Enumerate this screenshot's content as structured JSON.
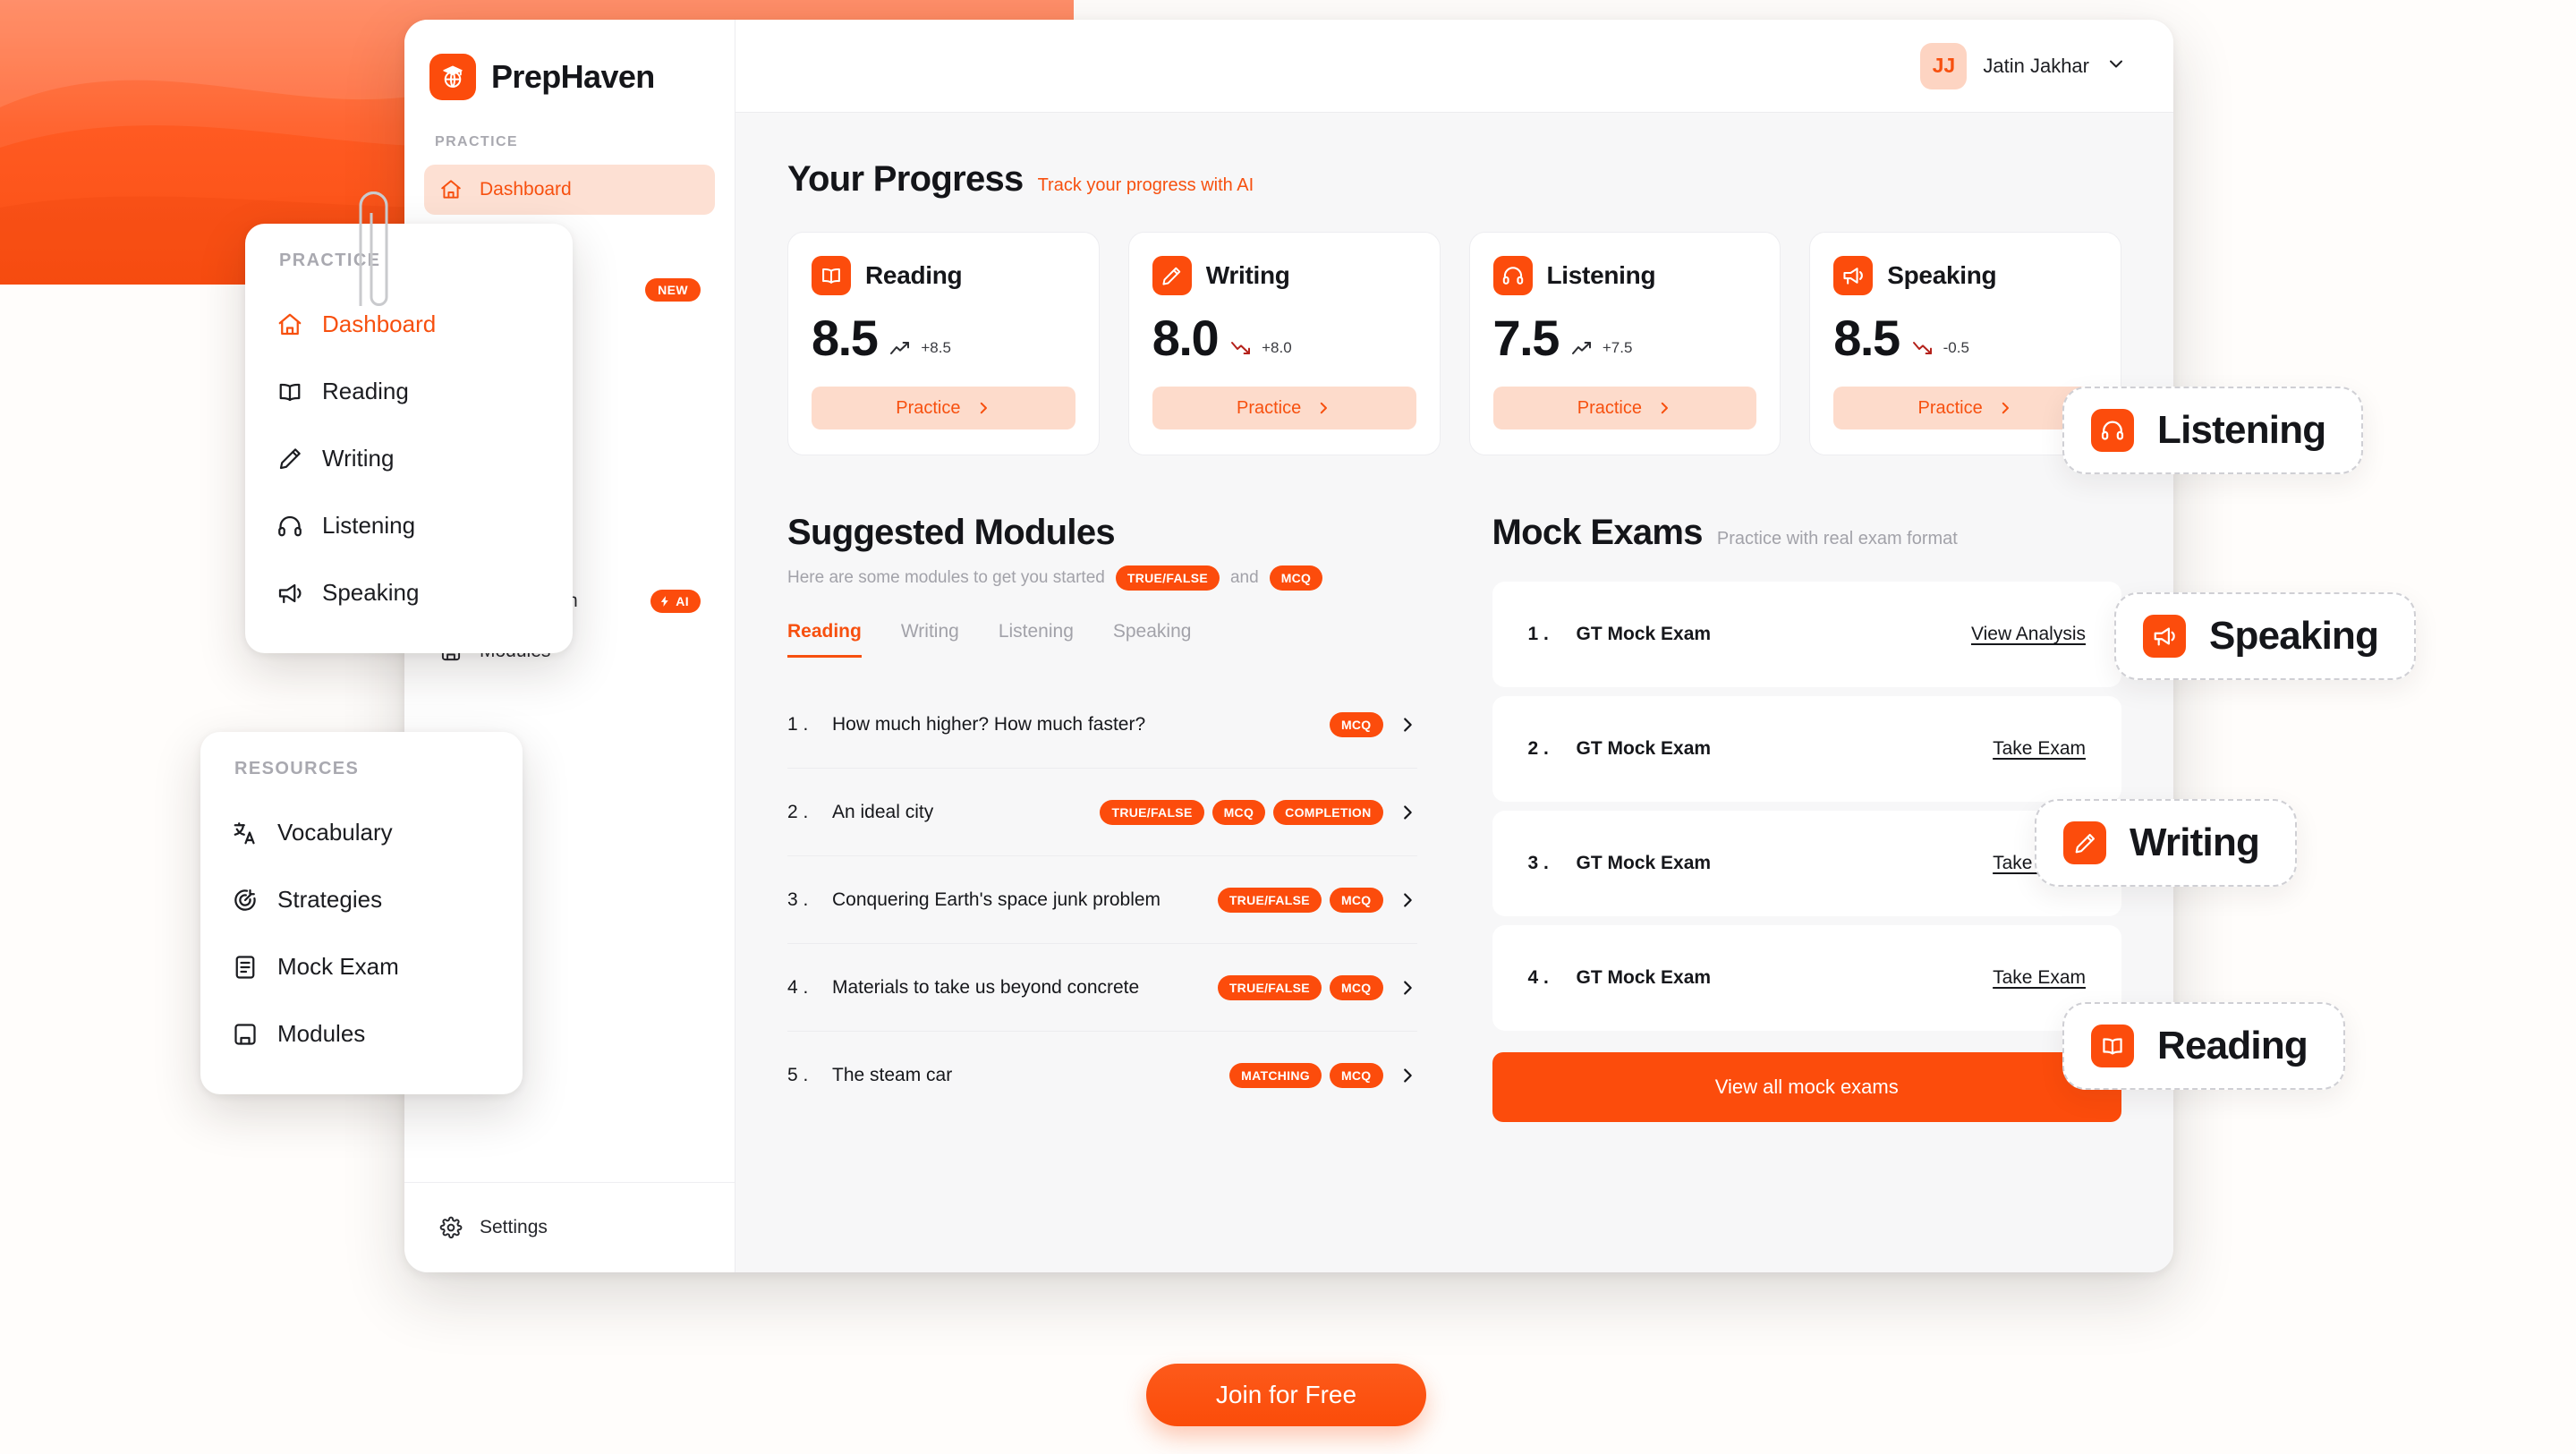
{
  "brand": {
    "name": "PrepHaven",
    "mark_icon": "graduation-globe-icon"
  },
  "header": {
    "user": {
      "initials": "JJ",
      "name": "Jatin Jakhar",
      "chevron_icon": "chevron-down-icon"
    }
  },
  "sidebar": {
    "section_label": "PRACTICE",
    "items": [
      {
        "label": "Dashboard",
        "icon": "home-icon",
        "active": true
      },
      {
        "label": "Reading",
        "icon": "book-icon",
        "active": false
      },
      {
        "label": "Writing",
        "icon": "pencil-icon",
        "active": false,
        "badge": "NEW"
      },
      {
        "label": "Listening",
        "icon": "headphones-icon",
        "active": false
      },
      {
        "label": "Speaking",
        "icon": "megaphone-icon",
        "active": false
      }
    ],
    "resources_label": "RESOURCES",
    "resource_items": [
      {
        "label": "Vocabulary",
        "icon": "translate-icon"
      },
      {
        "label": "Strategies",
        "icon": "target-icon"
      },
      {
        "label": "Mock Exam",
        "icon": "document-icon",
        "badge": "AI"
      },
      {
        "label": "Modules",
        "icon": "notebook-icon"
      }
    ],
    "settings": {
      "label": "Settings",
      "icon": "gear-icon"
    }
  },
  "progress": {
    "title": "Your Progress",
    "subtitle": "Track your progress with AI",
    "cards": [
      {
        "label": "Reading",
        "icon": "book-icon",
        "score": "8.5",
        "delta": "+8.5",
        "trend": "up",
        "button": "Practice"
      },
      {
        "label": "Writing",
        "icon": "pencil-icon",
        "score": "8.0",
        "delta": "+8.0",
        "trend": "down",
        "button": "Practice"
      },
      {
        "label": "Listening",
        "icon": "headphones-icon",
        "score": "7.5",
        "delta": "+7.5",
        "trend": "up",
        "button": "Practice"
      },
      {
        "label": "Speaking",
        "icon": "megaphone-icon",
        "score": "8.5",
        "delta": "-0.5",
        "trend": "down",
        "button": "Practice"
      }
    ]
  },
  "modules": {
    "title": "Suggested Modules",
    "note_prefix": "Here are some modules to get you started",
    "note_tag_1": "TRUE/FALSE",
    "note_and": "and",
    "note_tag_2": "MCQ",
    "tabs": [
      {
        "label": "Reading",
        "active": true
      },
      {
        "label": "Writing",
        "active": false
      },
      {
        "label": "Listening",
        "active": false
      },
      {
        "label": "Speaking",
        "active": false
      }
    ],
    "rows": [
      {
        "num": "1 .",
        "name": "How much higher? How much faster?",
        "tags": [
          "MCQ"
        ]
      },
      {
        "num": "2 .",
        "name": "An ideal city",
        "tags": [
          "TRUE/FALSE",
          "MCQ",
          "COMPLETION"
        ]
      },
      {
        "num": "3 .",
        "name": "Conquering Earth's space junk problem",
        "tags": [
          "TRUE/FALSE",
          "MCQ"
        ]
      },
      {
        "num": "4 .",
        "name": "Materials to take us beyond concrete",
        "tags": [
          "TRUE/FALSE",
          "MCQ"
        ]
      },
      {
        "num": "5 .",
        "name": "The steam car",
        "tags": [
          "MATCHING",
          "MCQ"
        ]
      }
    ]
  },
  "mock_exams": {
    "title": "Mock Exams",
    "subtitle": "Practice with real exam format",
    "rows": [
      {
        "num": "1 .",
        "name": "GT Mock Exam",
        "action": "View Analysis"
      },
      {
        "num": "2 .",
        "name": "GT Mock Exam",
        "action": "Take Exam"
      },
      {
        "num": "3 .",
        "name": "GT Mock Exam",
        "action": "Take Exam"
      },
      {
        "num": "4 .",
        "name": "GT Mock Exam",
        "action": "Take Exam"
      }
    ],
    "view_all": "View all mock exams"
  },
  "overlays": {
    "practice_menu": {
      "header": "PRACTICE",
      "items": [
        {
          "label": "Dashboard",
          "icon": "home-icon",
          "active": true
        },
        {
          "label": "Reading",
          "icon": "book-icon",
          "active": false
        },
        {
          "label": "Writing",
          "icon": "pencil-icon",
          "active": false
        },
        {
          "label": "Listening",
          "icon": "headphones-icon",
          "active": false
        },
        {
          "label": "Speaking",
          "icon": "megaphone-icon",
          "active": false
        }
      ]
    },
    "resources_menu": {
      "header": "RESOURCES",
      "items": [
        {
          "label": "Vocabulary",
          "icon": "translate-icon"
        },
        {
          "label": "Strategies",
          "icon": "target-icon"
        },
        {
          "label": "Mock Exam",
          "icon": "document-icon"
        },
        {
          "label": "Modules",
          "icon": "notebook-icon"
        }
      ]
    },
    "badges": [
      {
        "label": "Listening",
        "icon": "headphones-icon"
      },
      {
        "label": "Speaking",
        "icon": "megaphone-icon"
      },
      {
        "label": "Writing",
        "icon": "pencil-icon"
      },
      {
        "label": "Reading",
        "icon": "book-icon"
      }
    ]
  },
  "cta": {
    "label": "Join for Free"
  },
  "colors": {
    "brand_orange": "#fc4c0c",
    "accent_orange": "#f7500f",
    "soft_orange": "#fddbcb",
    "hero_top": "#ff7a4d",
    "hero_bottom": "#fa4f12",
    "trend_down": "#b4211a",
    "trend_up": "#2c2d32"
  }
}
